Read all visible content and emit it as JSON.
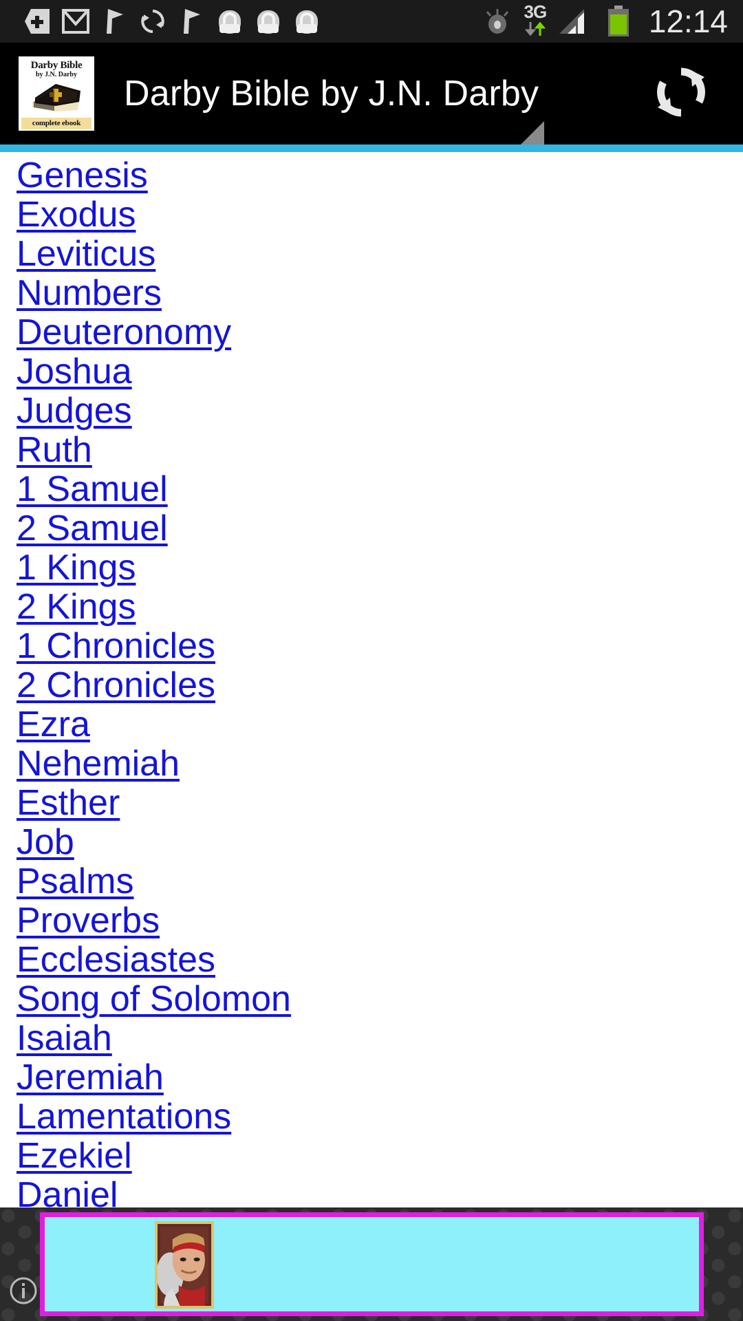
{
  "status_bar": {
    "icons": [
      {
        "name": "download-badge-icon"
      },
      {
        "name": "gmail-icon"
      },
      {
        "name": "flag-icon"
      },
      {
        "name": "sync-icon"
      },
      {
        "name": "flag-icon"
      },
      {
        "name": "bag-icon"
      },
      {
        "name": "bag-icon"
      },
      {
        "name": "bag-icon"
      }
    ],
    "eye_icon": "eye-icon",
    "network_label": "3G",
    "network_updown_icon": "data-transfer-icon",
    "signal_icon": "signal-bars-icon",
    "battery_icon": "battery-icon",
    "time": "12:14",
    "background_color": "#1b1b1b",
    "text_color": "#e8e8e8",
    "battery_color": "#7bc400"
  },
  "app_bar": {
    "icon": {
      "title": "Darby Bible",
      "subtitle": "by J.N. Darby",
      "footer": "complete ebook",
      "name": "app-icon-darby-bible"
    },
    "title": "Darby Bible by J.N. Darby",
    "refresh_icon": "refresh-icon",
    "menu_indicator_icon": "context-menu-triangle-icon",
    "background_color": "#000000",
    "title_color": "#ffffff",
    "divider_color": "#33b5e5"
  },
  "book_list": {
    "link_color": "#1414d8",
    "background_color": "#ffffff",
    "books": [
      "Genesis",
      "Exodus",
      "Leviticus",
      "Numbers",
      "Deuteronomy",
      "Joshua",
      "Judges",
      "Ruth",
      "1 Samuel",
      "2 Samuel",
      "1 Kings",
      "2 Kings",
      "1 Chronicles",
      "2 Chronicles",
      "Ezra",
      "Nehemiah",
      "Esther",
      "Job",
      "Psalms",
      "Proverbs",
      "Ecclesiastes",
      "Song of Solomon",
      "Isaiah",
      "Jeremiah",
      "Lamentations",
      "Ezekiel",
      "Daniel"
    ]
  },
  "ad_banner": {
    "info_icon": "ad-info-icon",
    "thumbnail_icon": "ad-character-portrait",
    "background_color": "#8ef0fb",
    "border_color": "#e01ee0",
    "surround_color": "#2b2b2b"
  }
}
